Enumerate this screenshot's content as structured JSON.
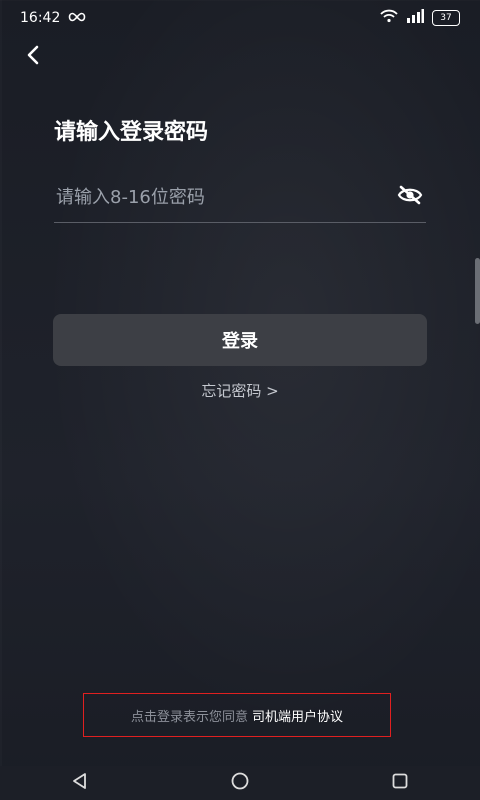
{
  "status_bar": {
    "time": "16:42",
    "battery": "37"
  },
  "header": {
    "title": "请输入登录密码"
  },
  "password": {
    "placeholder": "请输入8-16位密码",
    "value": ""
  },
  "login_button": "登录",
  "forgot_link": "忘记密码 >",
  "agreement": {
    "prefix": "点击登录表示您同意",
    "link": "司机端用户协议"
  },
  "icons": {
    "back": "back-arrow-icon",
    "eye": "eye-off-icon",
    "nav": [
      "back-triangle-icon",
      "home-circle-icon",
      "recents-square-icon"
    ]
  },
  "colors": {
    "highlight_border": "#e02020",
    "button_bg": "#3d3f45"
  }
}
